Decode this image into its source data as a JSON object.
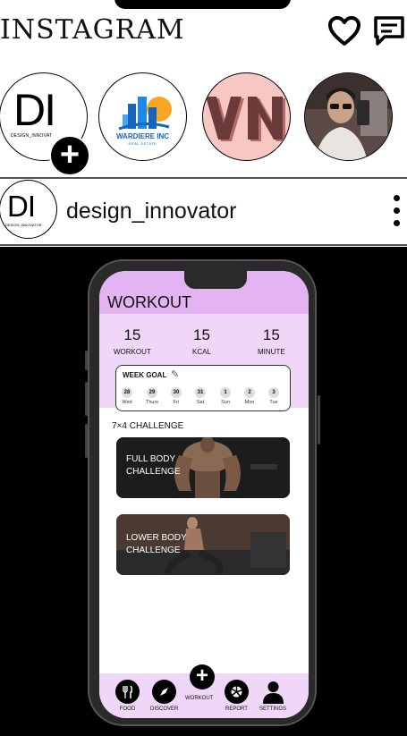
{
  "header": {
    "app_title": "INSTAGRAM",
    "icons": [
      "heart-icon",
      "messages-icon"
    ]
  },
  "stories": [
    {
      "logo": "DI",
      "caption": "DESIGN_INNOVAT",
      "add_icon": "plus-icon"
    },
    {
      "brand": "WARDIERE INC",
      "sub": "REAL ESTATE"
    },
    {
      "monogram": "VN"
    },
    {
      "image": "user-photo"
    }
  ],
  "post": {
    "avatar_text": "DI",
    "avatar_sub": "DESIGN_INNOVATOR",
    "username": "design_innovator",
    "menu_icon": "more-vertical-icon"
  },
  "workout_app": {
    "title": "WORKOUT",
    "stats": [
      {
        "value": "15",
        "label": "WORKOUT"
      },
      {
        "value": "15",
        "label": "KCAL"
      },
      {
        "value": "15",
        "label": "MINUTE"
      }
    ],
    "week_goal": {
      "title": "WEEK  GOAL",
      "days": [
        {
          "num": "28",
          "label": "Wed"
        },
        {
          "num": "29",
          "label": "Thurs"
        },
        {
          "num": "30",
          "label": "Fri"
        },
        {
          "num": "31",
          "label": "Sat"
        },
        {
          "num": "1",
          "label": "Sun"
        },
        {
          "num": "2",
          "label": "Mon"
        },
        {
          "num": "3",
          "label": "Tue"
        }
      ]
    },
    "challenge_title": "7×4 CHALLENGE",
    "challenges": [
      {
        "line1": "FULL BODY",
        "line2": "CHALLENGE"
      },
      {
        "line1": "LOWER BODY",
        "line2": "CHALLENGE"
      }
    ],
    "tabs": [
      {
        "label": "FOOD",
        "icon": "fork-knife-icon"
      },
      {
        "label": "DISCOVER",
        "icon": "compass-icon"
      },
      {
        "label": "WORKOUT",
        "icon": "plus-icon"
      },
      {
        "label": "REPORT",
        "icon": "pie-chart-icon"
      },
      {
        "label": "SETTINGS",
        "icon": "user-icon"
      }
    ]
  },
  "colors": {
    "accent_purple": "#e4b3f2",
    "light_purple": "#f0d7f7",
    "vn_pink": "#f7c7c3",
    "wardiere_blue": "#1565c0"
  }
}
